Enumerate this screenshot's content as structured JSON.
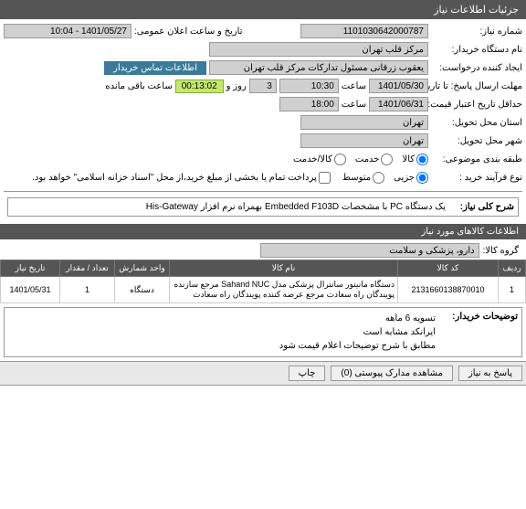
{
  "header": {
    "title": "جزئیات اطلاعات نیاز"
  },
  "fields": {
    "need_no_lbl": "شماره نیاز:",
    "need_no": "1101030642000787",
    "announce_lbl": "تاریخ و ساعت اعلان عمومی:",
    "announce": "1401/05/27 - 10:04",
    "buyer_lbl": "نام دستگاه خریدار:",
    "buyer": "مرکز قلب تهران",
    "creator_lbl": "ایجاد کننده درخواست:",
    "creator": "یعقوب زرقانی مسئول تدارکات مرکز قلب تهران",
    "contact_btn": "اطلاعات تماس خریدار",
    "deadline_lbl": "مهلت ارسال پاسخ: تا تاریخ:",
    "deadline_date": "1401/05/30",
    "time_lbl": "ساعت",
    "deadline_time": "10:30",
    "days": "3",
    "day_lbl": "روز و",
    "timer": "00:13:02",
    "remain_lbl": "ساعت باقی مانده",
    "validity_lbl": "حداقل تاریخ اعتبار قیمت: تا تاریخ:",
    "validity_date": "1401/06/31",
    "validity_time": "18:00",
    "city_lbl": "استان محل تحویل:",
    "city": "تهران",
    "city2_lbl": "شهر محل تحویل:",
    "city2": "تهران",
    "class_lbl": "طبقه بندی موضوعی:",
    "class_goods": "کالا",
    "class_service": "خدمت",
    "class_both": "کالا/خدمت",
    "proc_lbl": "نوع فرآیند خرید :",
    "proc_part": "جزیی",
    "proc_med": "متوسط",
    "proc_note": "پرداخت تمام یا بخشی از مبلغ خرید،از محل \"اسناد خزانه اسلامی\" خواهد بود.",
    "desc_lbl": "شرح کلی نیاز:",
    "desc_val": "یک دستگاه PC با مشخصات Embedded  F103D بهمراه نرم افزار His-Gateway"
  },
  "items_header": "اطلاعات کالاهای مورد نیاز",
  "group_lbl": "گروه کالا:",
  "group_val": "دارو، پزشکی و سلامت",
  "cols": {
    "row": "ردیف",
    "code": "کد کالا",
    "name": "نام کالا",
    "unit": "واحد شمارش",
    "qty": "تعداد / مقدار",
    "date": "تاریخ نیاز"
  },
  "rows": [
    {
      "n": "1",
      "code": "2131660138870010",
      "name": "دستگاه مانیتور سانترال پزشکی مدل Sahand NUC مرجع سازنده پویندگان راه سعادت مرجع عرضه کننده پویندگان راه سعادت",
      "unit": "دستگاه",
      "qty": "1",
      "date": "1401/05/31"
    }
  ],
  "notes_lbl": "توضیحات خریدار:",
  "notes": {
    "l1": "تسویه 6 ماهه",
    "l2": "ایرانکد مشابه است",
    "l3": "مطابق با شرح توضیحات اعلام قیمت شود"
  },
  "buttons": {
    "reply": "پاسخ به نیاز",
    "docs": "مشاهده مدارک پیوستی (0)",
    "print": "چاپ"
  }
}
